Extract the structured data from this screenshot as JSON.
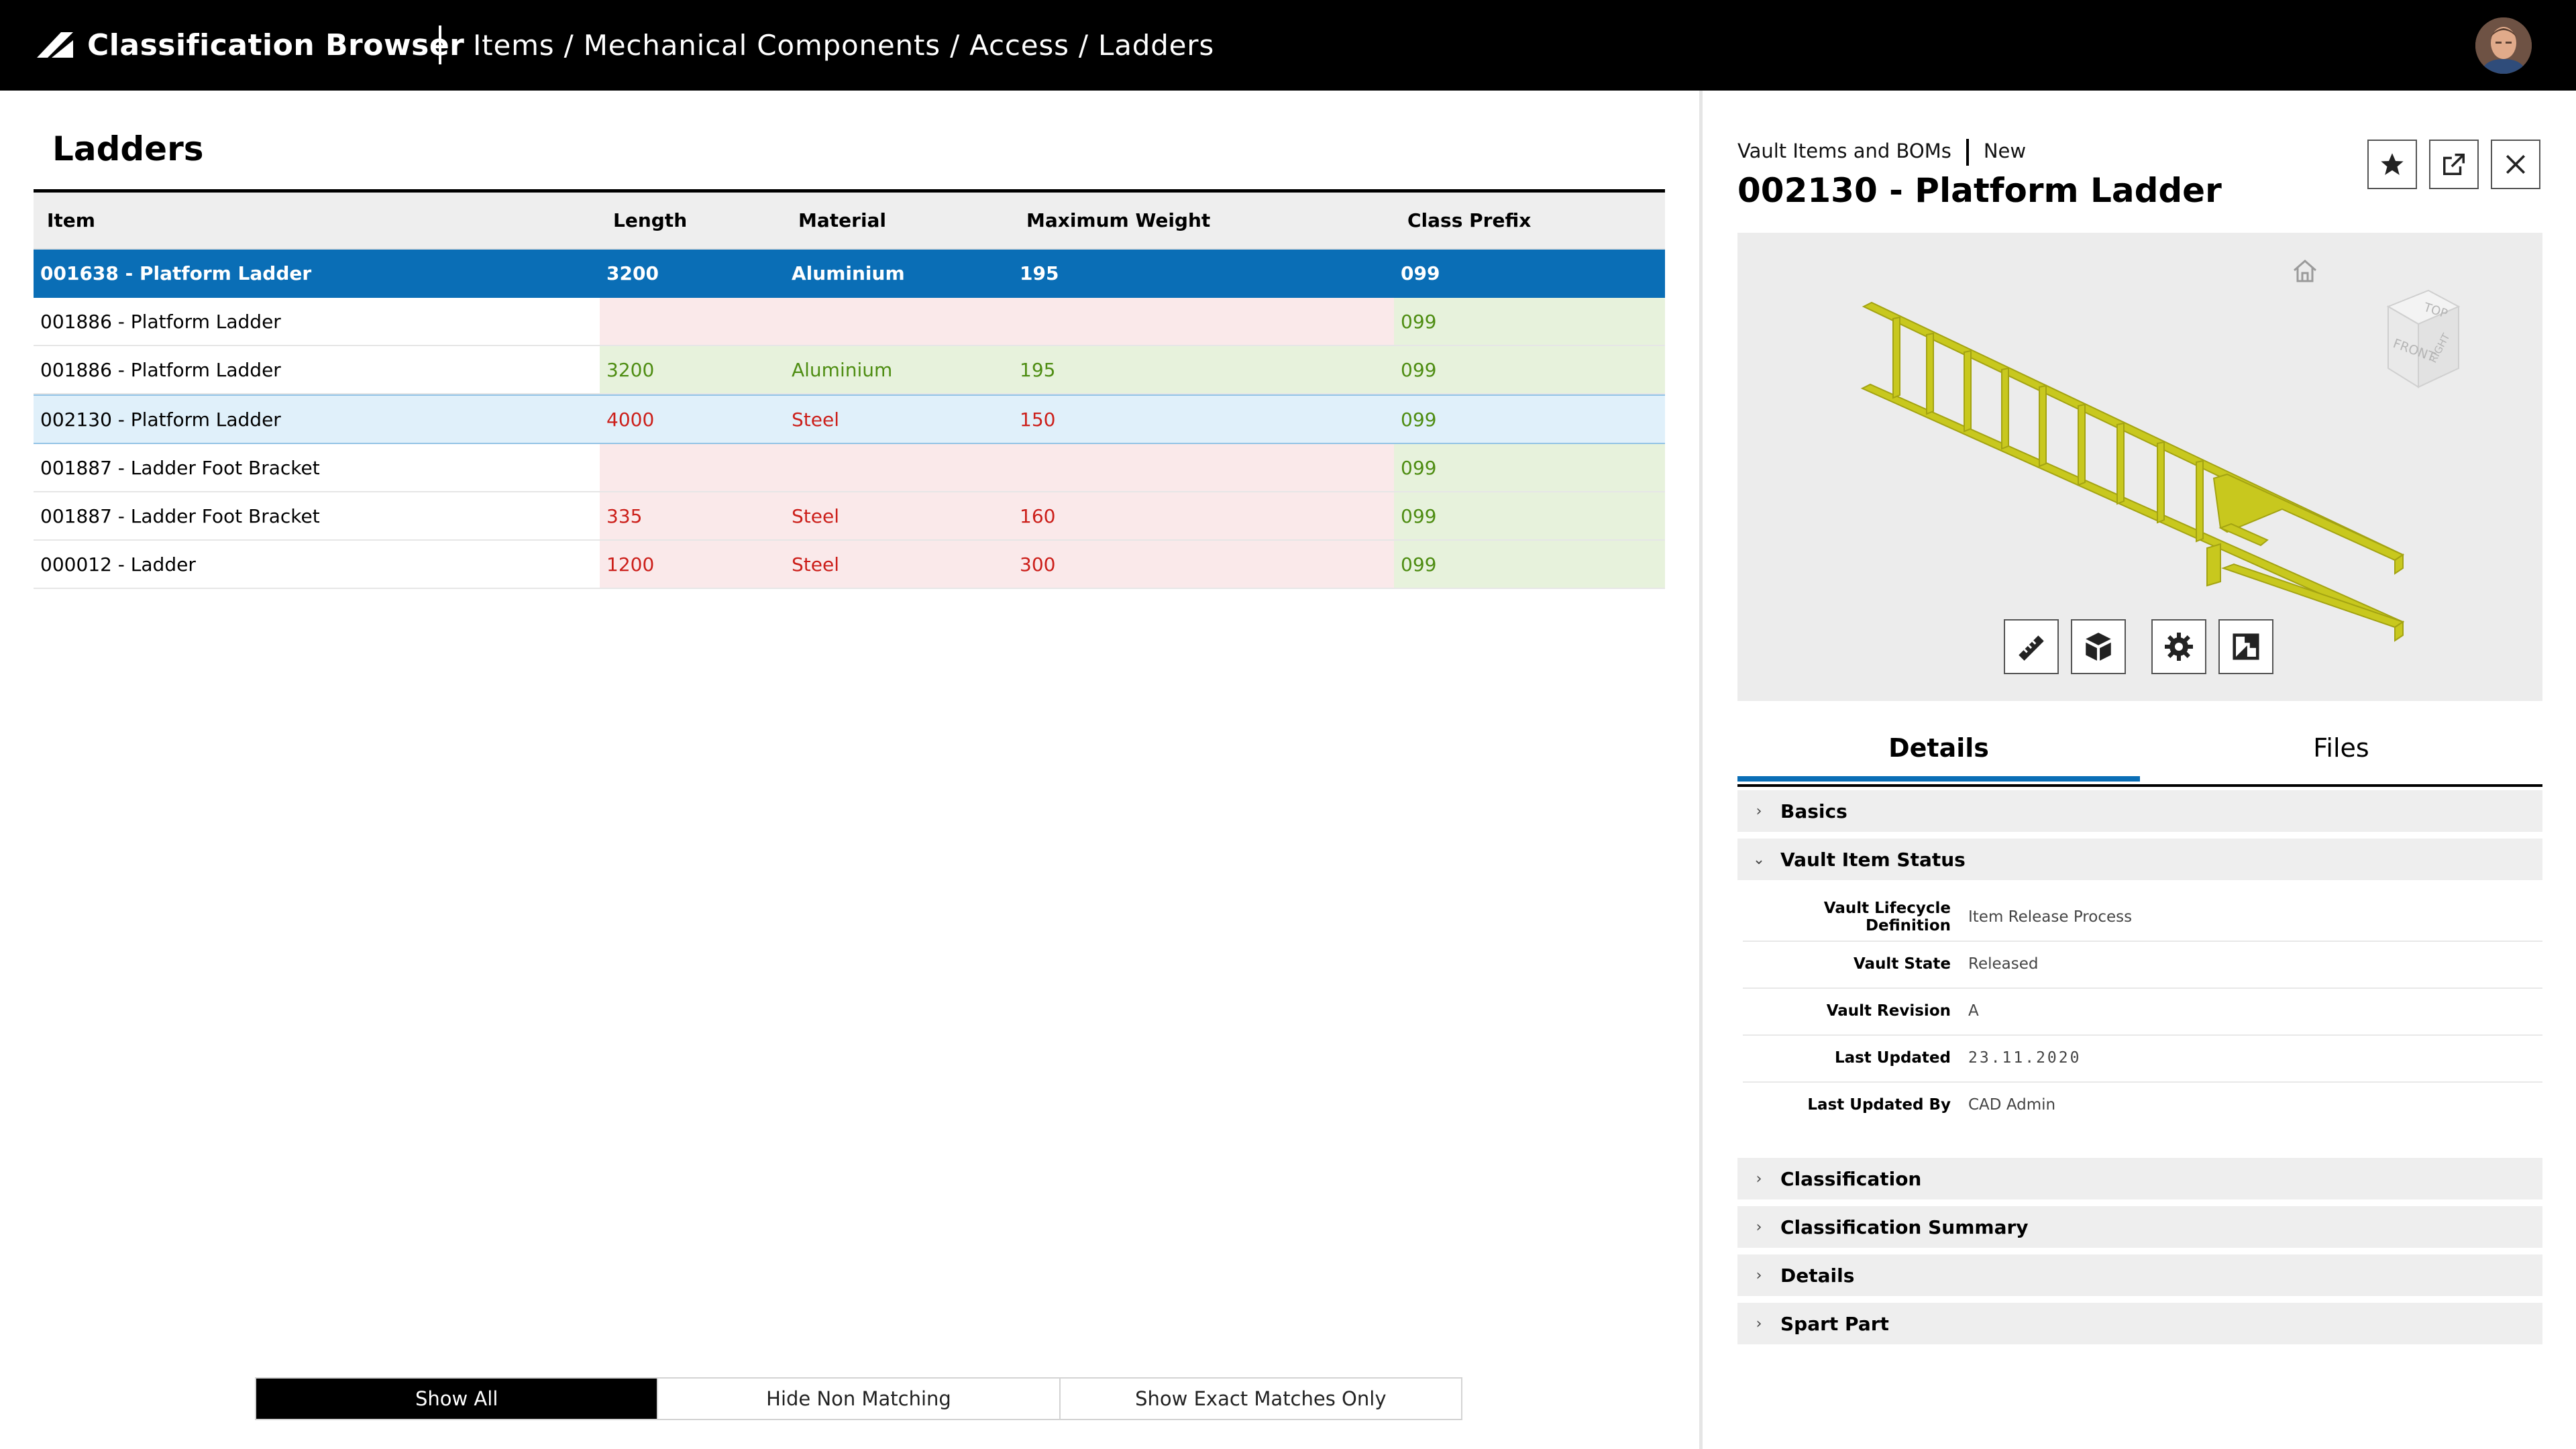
{
  "header": {
    "app_title": "Classification Browser",
    "breadcrumb": "Items / Mechanical Components / Access / Ladders"
  },
  "list": {
    "title": "Ladders",
    "columns": [
      "Item",
      "Length",
      "Material",
      "Maximum Weight",
      "Class Prefix"
    ],
    "rows": [
      {
        "item": "001638 - Platform Ladder",
        "length": "3200",
        "material": "Aluminium",
        "max_weight": "195",
        "class_prefix": "099"
      },
      {
        "item": "001886 - Platform Ladder",
        "length": "",
        "material": "",
        "max_weight": "",
        "class_prefix": "099"
      },
      {
        "item": "001886 - Platform Ladder",
        "length": "3200",
        "material": "Aluminium",
        "max_weight": "195",
        "class_prefix": "099"
      },
      {
        "item": "002130 - Platform Ladder",
        "length": "4000",
        "material": "Steel",
        "max_weight": "150",
        "class_prefix": "099"
      },
      {
        "item": "001887 - Ladder Foot Bracket",
        "length": "",
        "material": "",
        "max_weight": "",
        "class_prefix": "099"
      },
      {
        "item": "001887 - Ladder Foot Bracket",
        "length": "335",
        "material": "Steel",
        "max_weight": "160",
        "class_prefix": "099"
      },
      {
        "item": "000012 - Ladder",
        "length": "1200",
        "material": "Steel",
        "max_weight": "300",
        "class_prefix": "099"
      }
    ]
  },
  "filters": {
    "show_all": "Show All",
    "hide_non_matching": "Hide Non Matching",
    "exact_only": "Show Exact Matches Only",
    "active": "Show All"
  },
  "details": {
    "context": "Vault Items and BOMs",
    "status": "New",
    "title": "002130 - Platform Ladder",
    "viewer": {
      "cube_top": "TOP",
      "cube_front": "FRONT",
      "cube_right": "RIGHT"
    },
    "tabs": [
      "Details",
      "Files"
    ],
    "sections": {
      "basics": "Basics",
      "vault_item_status": "Vault Item Status",
      "classification": "Classification",
      "classification_summary": "Classification Summary",
      "details": "Details",
      "spart_part": "Spart Part"
    },
    "properties": [
      {
        "key": "Vault Lifecycle Definition",
        "value": "Item Release Process"
      },
      {
        "key": "Vault State",
        "value": "Released"
      },
      {
        "key": "Vault Revision",
        "value": "A"
      },
      {
        "key": "Last Updated",
        "value": "23.11.2020"
      },
      {
        "key": "Last Updated By",
        "value": "CAD Admin"
      }
    ]
  },
  "colors": {
    "accent": "#0a6eb6",
    "match_green": "#4e8d12",
    "mismatch_red": "#cc1f1a",
    "ladder_yellow": "#c8c81e"
  },
  "icons": [
    "autodesk-logo-icon",
    "user-avatar",
    "star-icon",
    "open-external-icon",
    "close-icon",
    "home-icon",
    "view-cube-icon",
    "measure-icon",
    "explode-icon",
    "settings-icon",
    "fit-view-icon",
    "chevron-right-icon",
    "chevron-down-icon"
  ]
}
